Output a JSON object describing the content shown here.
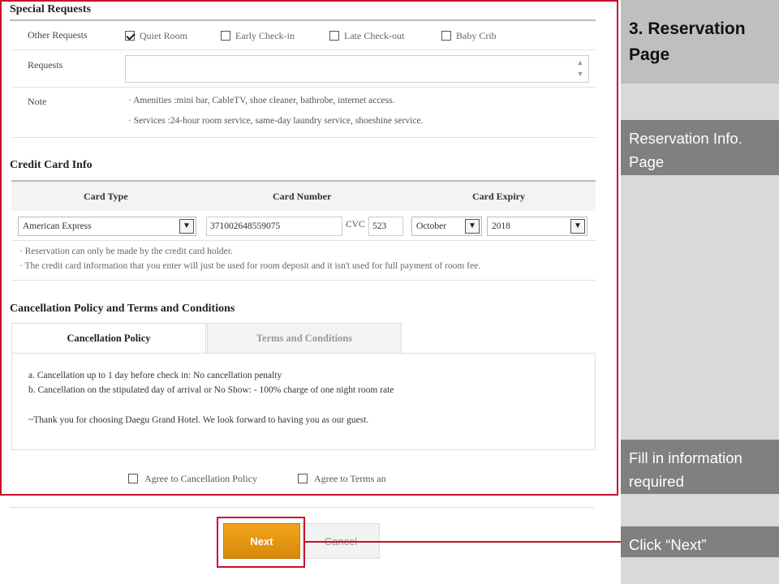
{
  "special_requests": {
    "title": "Special Requests",
    "other_label": "Other Requests",
    "options": [
      {
        "label": "Quiet Room",
        "checked": true
      },
      {
        "label": "Early Check-in",
        "checked": false
      },
      {
        "label": "Late Check-out",
        "checked": false
      },
      {
        "label": "Baby Crib",
        "checked": false
      }
    ],
    "requests_label": "Requests",
    "requests_value": "",
    "note_label": "Note",
    "note_lines": [
      "· Amenities :mini bar, CableTV, shoe cleaner, bathrobe, internet access.",
      "· Services :24-hour room service, same-day laundry service, shoeshine service."
    ]
  },
  "credit_card": {
    "title": "Credit Card Info",
    "col_card_type": "Card Type",
    "col_card_number": "Card Number",
    "col_card_expiry": "Card Expiry",
    "card_type": "American Express",
    "card_number": "371002648559075",
    "cvc_label": "CVC",
    "cvc": "523",
    "expiry_month": "October",
    "expiry_year": "2018",
    "notes": [
      "· Reservation can only be made by the credit card holder.",
      "· The credit card information that you enter will just be used for room deposit and it isn't used for full payment of room fee."
    ]
  },
  "cancellation": {
    "title": "Cancellation Policy and Terms and Conditions",
    "tab_policy": "Cancellation Policy",
    "tab_terms": "Terms and Conditions",
    "lines": [
      "a. Cancellation up to 1 day before check in: No cancellation penalty",
      "b. Cancellation on the stipulated day of arrival or No Show: - 100% charge of one night room rate",
      "~Thank you for choosing Daegu Grand Hotel. We look forward to having you as our guest."
    ],
    "agree_policy": "Agree to Cancellation Policy",
    "agree_terms": "Agree to Terms an"
  },
  "buttons": {
    "next": "Next",
    "cancel": "Cancel"
  },
  "sidebar": {
    "title": "3. Reservation Page",
    "box1": "Reservation Info. Page",
    "box2": "Fill in information required",
    "box3": "Click “Next”"
  },
  "colors": {
    "highlight": "#c8102e",
    "next_button": "#e8980f",
    "sidebar_box": "#808080"
  }
}
